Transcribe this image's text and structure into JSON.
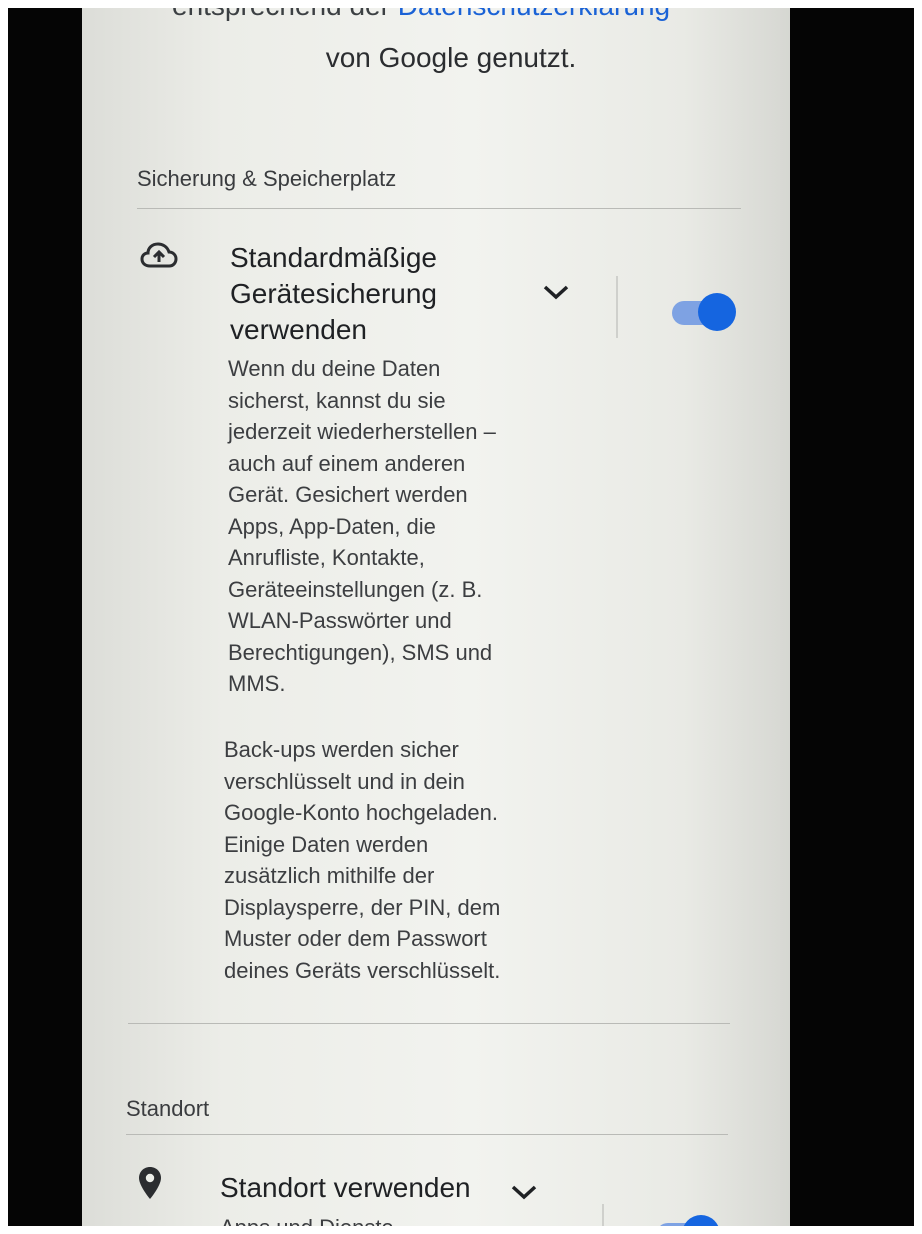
{
  "top_text": {
    "cut_prefix": "entsprechend der",
    "privacy_link": "Datenschutzerklärung",
    "consent_line": "von Google genutzt."
  },
  "backup_section": {
    "header": "Sicherung & Speicherplatz",
    "setting": {
      "icon": "cloud-upload-icon",
      "title_lines": [
        "Standardmäßige",
        "Gerätesicherung",
        "verwenden"
      ],
      "expand_icon": "chevron-down-icon",
      "toggle_on": true,
      "description_para1": [
        "Wenn du deine Daten",
        "sicherst, kannst du sie",
        "jederzeit wiederherstellen –",
        "auch auf einem anderen",
        "Gerät. Gesichert werden",
        "Apps, App-Daten, die",
        "Anrufliste, Kontakte,",
        "Geräteeinstellungen (z. B.",
        "WLAN-Passwörter und",
        "Berechtigungen), SMS und",
        "MMS."
      ],
      "description_para2": [
        "Back-ups werden sicher",
        "verschlüsselt und in dein",
        "Google-Konto hochgeladen.",
        "Einige Daten werden",
        "zusätzlich mithilfe der",
        "Displaysperre, der PIN, dem",
        "Muster oder dem Passwort",
        "deines Geräts verschlüsselt."
      ]
    }
  },
  "location_section": {
    "header": "Standort",
    "setting": {
      "icon": "location-pin-icon",
      "title": "Standort verwenden",
      "expand_icon": "chevron-down-icon",
      "description_partial": "Apps und Dienste",
      "toggle_on": true
    }
  },
  "colors": {
    "accent": "#1565e0",
    "link": "#1a62d6",
    "toggle_track": "#7ea2e3"
  }
}
